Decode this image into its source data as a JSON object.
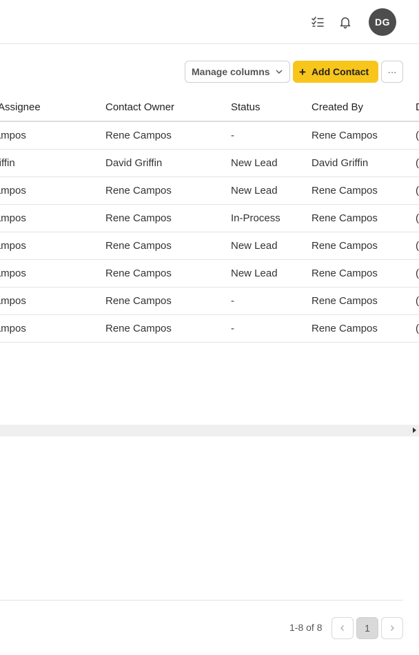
{
  "header": {
    "avatar_initials": "DG"
  },
  "toolbar": {
    "manage_columns_label": "Manage columns",
    "add_contact_label": "Add Contact",
    "add_icon": "+",
    "more_label": "···"
  },
  "table": {
    "columns": [
      "ct Assignee",
      "Contact Owner",
      "Status",
      "Created By",
      "D"
    ],
    "rows": [
      [
        "Campos",
        "Rene Campos",
        "-",
        "Rene Campos",
        "("
      ],
      [
        "Griffin",
        "David Griffin",
        "New Lead",
        "David Griffin",
        "("
      ],
      [
        "Campos",
        "Rene Campos",
        "New Lead",
        "Rene Campos",
        "("
      ],
      [
        "Campos",
        "Rene Campos",
        "In-Process",
        "Rene Campos",
        "("
      ],
      [
        "Campos",
        "Rene Campos",
        "New Lead",
        "Rene Campos",
        "("
      ],
      [
        "Campos",
        "Rene Campos",
        "New Lead",
        "Rene Campos",
        "("
      ],
      [
        "Campos",
        "Rene Campos",
        "-",
        "Rene Campos",
        "("
      ],
      [
        "Campos",
        "Rene Campos",
        "-",
        "Rene Campos",
        "("
      ]
    ]
  },
  "pagination": {
    "range_text": "1-8 of 8",
    "current_page": "1"
  },
  "colors": {
    "accent": "#f8c51c",
    "avatar_bg": "#4d4d4d"
  }
}
